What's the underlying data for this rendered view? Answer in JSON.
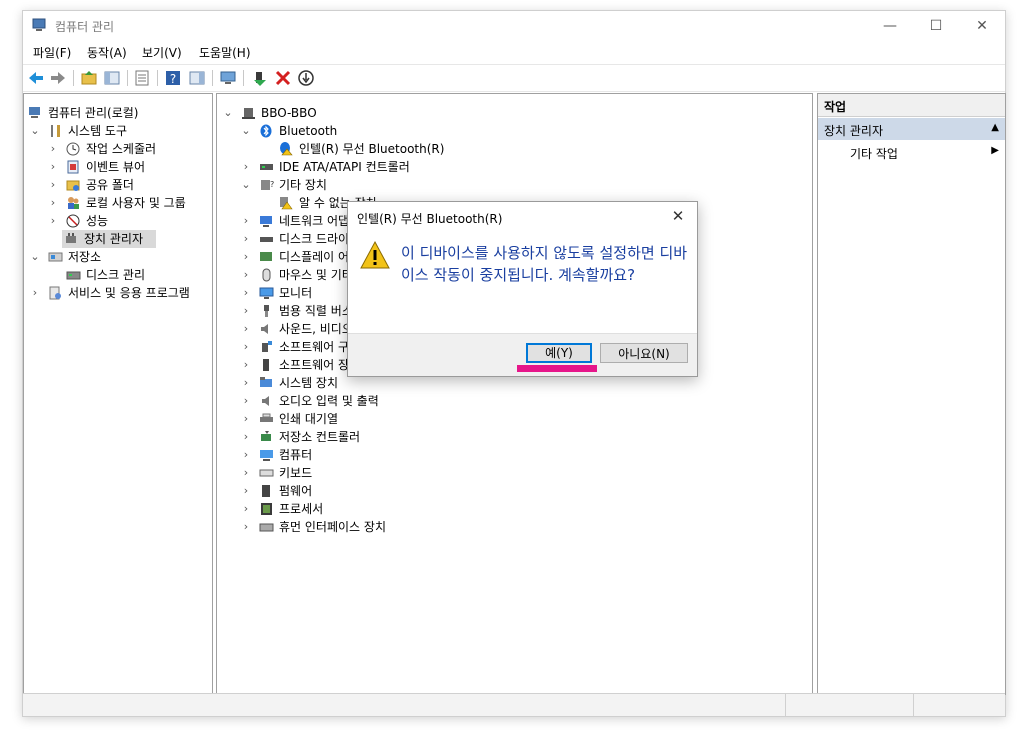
{
  "window": {
    "title": "컴퓨터 관리"
  },
  "menu": [
    "파일(F)",
    "동작(A)",
    "보기(V)",
    "도움말(H)"
  ],
  "left_tree": [
    {
      "label": "컴퓨터 관리(로컬)"
    },
    {
      "label": "시스템 도구"
    },
    {
      "label": "작업 스케줄러"
    },
    {
      "label": "이벤트 뷰어"
    },
    {
      "label": "공유 폴더"
    },
    {
      "label": "로컬 사용자 및 그룹"
    },
    {
      "label": "성능"
    },
    {
      "label": "장치 관리자"
    },
    {
      "label": "저장소"
    },
    {
      "label": "디스크 관리"
    },
    {
      "label": "서비스 및 응용 프로그램"
    }
  ],
  "device_tree": {
    "root": "BBO-BBO",
    "bluetooth": "Bluetooth",
    "bluetooth_child": "인텔(R) 무선 Bluetooth(R)",
    "ide": "IDE ATA/ATAPI 컨트롤러",
    "other": "기타 장치",
    "other_child": "알 수 없는 장치",
    "categories": [
      "네트워크 어댑터",
      "디스크 드라이브",
      "디스플레이 어댑터",
      "마우스 및 기타 포인팅 장치",
      "모니터",
      "범용 직렬 버스 컨트롤러",
      "사운드, 비디오 및 게임 컨트롤러",
      "소프트웨어 구성 요소",
      "소프트웨어 장치",
      "시스템 장치",
      "오디오 입력 및 출력",
      "인쇄 대기열",
      "저장소 컨트롤러",
      "컴퓨터",
      "키보드",
      "펌웨어",
      "프로세서",
      "휴먼 인터페이스 장치"
    ]
  },
  "actions": {
    "header": "작업",
    "section": "장치 관리자",
    "item": "기타 작업"
  },
  "dialog": {
    "title": "인텔(R) 무선 Bluetooth(R)",
    "message": "이 디바이스를 사용하지 않도록 설정하면 디바이스 작동이 중지됩니다. 계속할까요?",
    "yes": "예(Y)",
    "no": "아니요(N)"
  },
  "colors": {
    "accent": "#0078d7",
    "highlight": "#e6168a",
    "message": "#1a3fa0"
  }
}
